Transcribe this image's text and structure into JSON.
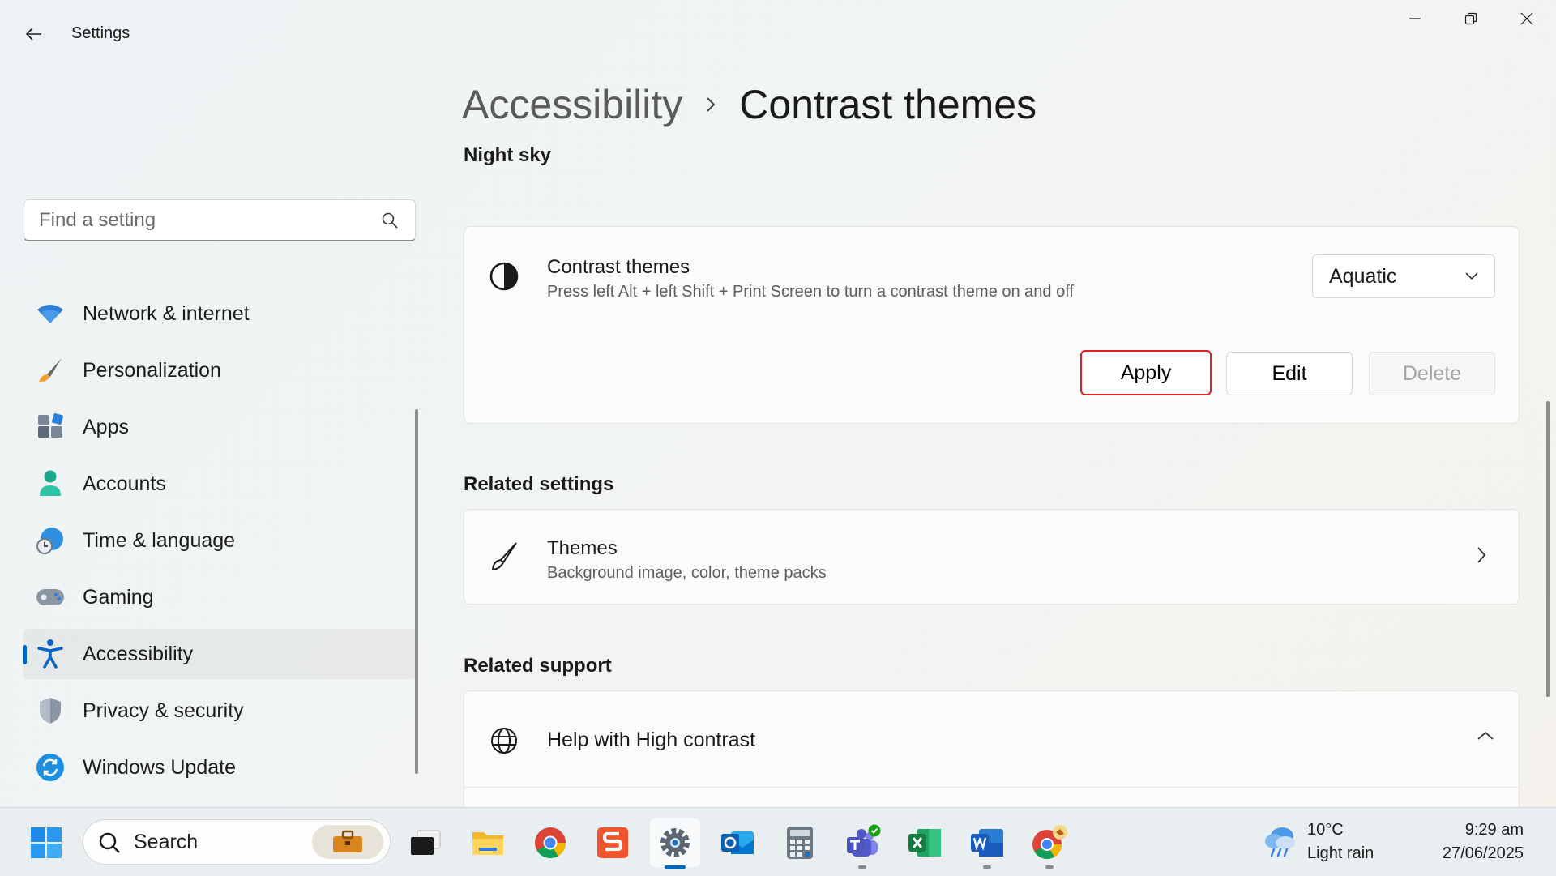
{
  "window": {
    "title": "Settings",
    "controls": [
      "minimize",
      "restore",
      "close"
    ]
  },
  "sidebar": {
    "search_placeholder": "Find a setting",
    "items": [
      {
        "label": "Network & internet",
        "icon": "wifi-icon"
      },
      {
        "label": "Personalization",
        "icon": "brush-icon"
      },
      {
        "label": "Apps",
        "icon": "apps-icon"
      },
      {
        "label": "Accounts",
        "icon": "person-icon"
      },
      {
        "label": "Time & language",
        "icon": "globe-clock-icon"
      },
      {
        "label": "Gaming",
        "icon": "gamepad-icon"
      },
      {
        "label": "Accessibility",
        "icon": "accessibility-icon",
        "selected": true
      },
      {
        "label": "Privacy & security",
        "icon": "shield-icon"
      },
      {
        "label": "Windows Update",
        "icon": "update-icon"
      }
    ]
  },
  "main": {
    "breadcrumb": {
      "parent": "Accessibility",
      "current": "Contrast themes"
    },
    "preview_label": "Night sky",
    "contrast_card": {
      "title": "Contrast themes",
      "description": "Press left Alt + left Shift + Print Screen to turn a contrast theme on and off",
      "selected_theme": "Aquatic",
      "buttons": {
        "apply": "Apply",
        "edit": "Edit",
        "delete": "Delete"
      }
    },
    "related_settings": {
      "heading": "Related settings",
      "themes": {
        "title": "Themes",
        "description": "Background image, color, theme packs"
      }
    },
    "related_support": {
      "heading": "Related support",
      "help": {
        "title": "Help with High contrast"
      }
    }
  },
  "taskbar": {
    "search_label": "Search",
    "apps": [
      "task-view",
      "file-explorer",
      "chrome",
      "sublime-text",
      "settings",
      "outlook",
      "calculator",
      "teams",
      "excel",
      "word",
      "chrome-profile"
    ],
    "weather": {
      "temp": "10°C",
      "desc": "Light rain"
    },
    "clock": {
      "time": "9:29 am",
      "date": "27/06/2025"
    }
  },
  "colors": {
    "accent": "#0067c0",
    "highlight_border": "#e0201e"
  }
}
